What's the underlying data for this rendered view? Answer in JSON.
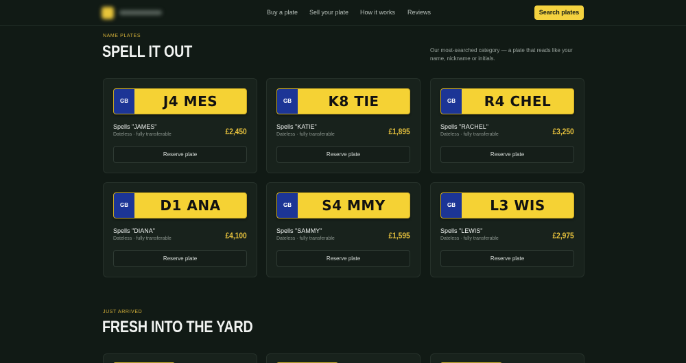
{
  "header": {
    "nav": [
      "Buy a plate",
      "Sell your plate",
      "How it works",
      "Reviews"
    ],
    "cta": "Search plates"
  },
  "name_plates": {
    "eyebrow": "NAME PLATES",
    "title": "SPELL IT OUT",
    "description": "Our most-searched category — a plate that reads like your name, nickname or initials.",
    "cards": [
      {
        "country": "GB",
        "reg": "J4 MES",
        "spells": "Spells \"JAMES\"",
        "meta": "Dateless · fully transferable",
        "price": "£2,450",
        "action": "Reserve plate"
      },
      {
        "country": "GB",
        "reg": "K8 TIE",
        "spells": "Spells \"KATIE\"",
        "meta": "Dateless · fully transferable",
        "price": "£1,895",
        "action": "Reserve plate"
      },
      {
        "country": "GB",
        "reg": "R4 CHEL",
        "spells": "Spells \"RACHEL\"",
        "meta": "Dateless · fully transferable",
        "price": "£3,250",
        "action": "Reserve plate"
      },
      {
        "country": "GB",
        "reg": "D1 ANA",
        "spells": "Spells \"DIANA\"",
        "meta": "Dateless · fully transferable",
        "price": "£4,100",
        "action": "Reserve plate"
      },
      {
        "country": "GB",
        "reg": "S4 MMY",
        "spells": "Spells \"SAMMY\"",
        "meta": "Dateless · fully transferable",
        "price": "£1,595",
        "action": "Reserve plate"
      },
      {
        "country": "GB",
        "reg": "L3 WIS",
        "spells": "Spells \"LEWIS\"",
        "meta": "Dateless · fully transferable",
        "price": "£2,975",
        "action": "Reserve plate"
      }
    ]
  },
  "just_arrived": {
    "eyebrow": "JUST ARRIVED",
    "title": "FRESH INTO THE YARD"
  },
  "colors": {
    "background": "#111a15",
    "accent": "#f4d23f",
    "price": "#e7c23d",
    "plate_yellow": "#f5d234",
    "plate_blue": "#1c3596"
  }
}
